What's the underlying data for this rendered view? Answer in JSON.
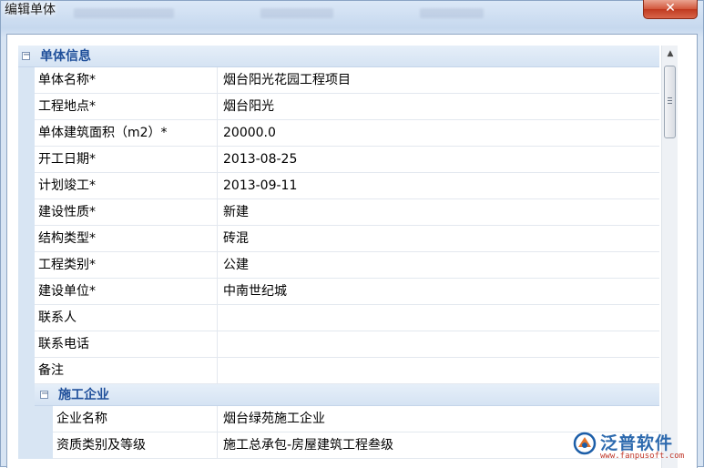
{
  "window": {
    "title": "编辑单体",
    "close_label": "✕"
  },
  "property_grid": {
    "main_category": {
      "toggle": "⊟",
      "label": "单体信息",
      "rows": [
        {
          "name": "单体名称*",
          "value": "烟台阳光花园工程项目"
        },
        {
          "name": "工程地点*",
          "value": "烟台阳光"
        },
        {
          "name": "单体建筑面积（m2）*",
          "value": "20000.0"
        },
        {
          "name": "开工日期*",
          "value": "2013-08-25"
        },
        {
          "name": "计划竣工*",
          "value": "2013-09-11"
        },
        {
          "name": "建设性质*",
          "value": "新建"
        },
        {
          "name": "结构类型*",
          "value": "砖混"
        },
        {
          "name": "工程类别*",
          "value": "公建"
        },
        {
          "name": "建设单位*",
          "value": "中南世纪城"
        },
        {
          "name": "联系人",
          "value": ""
        },
        {
          "name": "联系电话",
          "value": ""
        },
        {
          "name": "备注",
          "value": ""
        }
      ]
    },
    "sub_category": {
      "toggle": "⊟",
      "label": "施工企业",
      "rows": [
        {
          "name": "企业名称",
          "value": "烟台绿苑施工企业"
        },
        {
          "name": "资质类别及等级",
          "value": "施工总承包-房屋建筑工程叁级"
        }
      ]
    }
  },
  "scrollbar": {
    "up_arrow_icon": "triangle-up"
  },
  "watermark": {
    "brand": "泛普软件",
    "url": "www.fanpusoft.com"
  }
}
